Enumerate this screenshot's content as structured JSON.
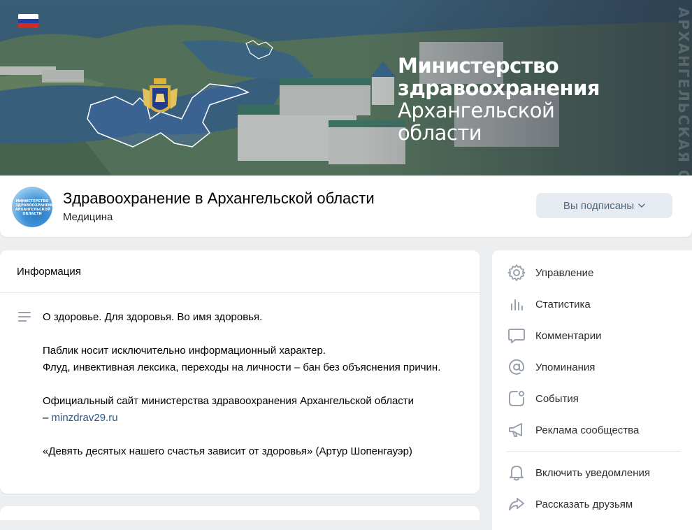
{
  "cover": {
    "title_line1": "Министерство",
    "title_line2": "здравоохранения",
    "title_line3": "Архангельской",
    "title_line4": "области",
    "vertical_text": "АРХАНГЕЛЬСКАЯ ОБЛАСТЬ"
  },
  "header": {
    "avatar_text": "МИНИСТЕРСТВО ЗДРАВООХРАНЕНИЯ АРХАНГЕЛЬСКОЙ ОБЛАСТИ",
    "title": "Здравоохранение в Архангельской области",
    "subtitle": "Медицина",
    "subscribe_label": "Вы подписаны"
  },
  "info": {
    "heading": "Информация",
    "line1": "О здоровье. Для здоровья. Во имя здоровья.",
    "line2": "Паблик носит исключительно информационный характер.",
    "line3": "Флуд, инвективная лексика, переходы на личности – бан без объяснения причин.",
    "line4": "Официальный сайт министерства здравоохранения Архангельской области",
    "line5_prefix": "– ",
    "link": "minzdrav29.ru",
    "line6": "«Девять десятых нашего счастья зависит от здоровья» (Артур Шопенгауэр)"
  },
  "menu": {
    "items": [
      {
        "label": "Управление",
        "icon": "gear-icon"
      },
      {
        "label": "Статистика",
        "icon": "stats-icon"
      },
      {
        "label": "Комментарии",
        "icon": "comment-icon"
      },
      {
        "label": "Упоминания",
        "icon": "at-icon"
      },
      {
        "label": "События",
        "icon": "events-icon"
      },
      {
        "label": "Реклама сообщества",
        "icon": "megaphone-icon"
      },
      {
        "label": "Включить уведомления",
        "icon": "bell-icon"
      },
      {
        "label": "Рассказать друзьям",
        "icon": "share-icon"
      }
    ]
  },
  "colors": {
    "accent": "#2a5885",
    "icon": "#99a2ad",
    "button_bg": "#e5ebf1",
    "button_text": "#55677d"
  }
}
